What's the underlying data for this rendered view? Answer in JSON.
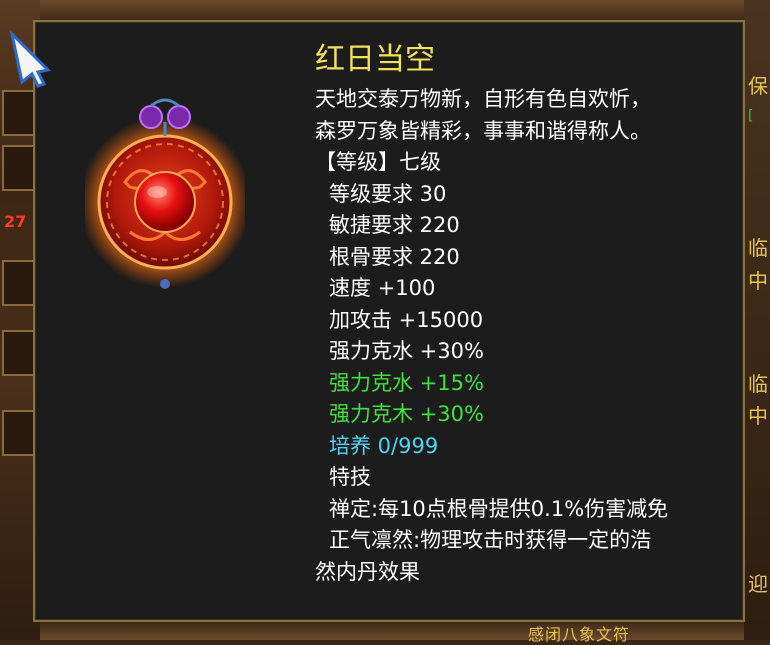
{
  "item": {
    "name": "红日当空",
    "description": [
      "天地交泰万物新，自形有色自欢忻，",
      "森罗万象皆精彩，事事和谐得称人。"
    ],
    "grade": "【等级】七级",
    "requirements": [
      "等级要求 30",
      "敏捷要求 220",
      "根骨要求 220"
    ],
    "stats": [
      "速度 +100",
      "加攻击 +15000",
      "强力克水 +30%"
    ],
    "bonus_stats": [
      "强力克水 +15%",
      "强力克木 +30%"
    ],
    "cultivation": "培养 0/999",
    "skills_header": "特技",
    "skills": [
      "禅定:每10点根骨提供0.1%伤害减免",
      "正气凛然:物理攻击时获得一定的浩",
      "然内丹效果"
    ],
    "icon": "red-sun-amulet-icon"
  },
  "background": {
    "left_number": "27",
    "right_glyphs": [
      "保",
      "[",
      "临",
      "中",
      "临",
      "中",
      "迎"
    ],
    "bottom_text": "感闭八象文符"
  },
  "colors": {
    "title": "#f2e34a",
    "normal": "#ffffff",
    "bonus": "#3fe03f",
    "cultivation": "#4ad6f2",
    "panel_bg": "#1c1c1c",
    "panel_border": "#8a7240"
  }
}
